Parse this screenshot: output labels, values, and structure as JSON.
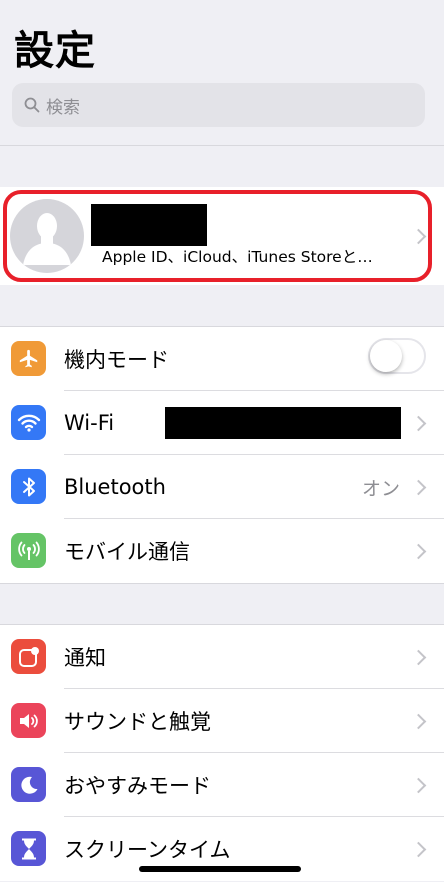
{
  "page": {
    "title": "設定"
  },
  "search": {
    "placeholder": "検索",
    "icon": "search-icon"
  },
  "profile": {
    "subtitle": "Apple ID、iCloud、iTunes Storeと…"
  },
  "groups": [
    {
      "items": [
        {
          "label": "機内モード",
          "icon": "airplane-icon",
          "color": "#f09a37",
          "toggle": false
        },
        {
          "label": "Wi-Fi",
          "icon": "wifi-icon",
          "color": "#3478f6"
        },
        {
          "label": "Bluetooth",
          "icon": "bluetooth-icon",
          "color": "#3478f6",
          "value": "オン"
        },
        {
          "label": "モバイル通信",
          "icon": "cellular-icon",
          "color": "#65c466"
        }
      ]
    },
    {
      "items": [
        {
          "label": "通知",
          "icon": "notifications-icon",
          "color": "#eb4d3d"
        },
        {
          "label": "サウンドと触覚",
          "icon": "speaker-icon",
          "color": "#eb445a"
        },
        {
          "label": "おやすみモード",
          "icon": "moon-icon",
          "color": "#5856d6"
        },
        {
          "label": "スクリーンタイム",
          "icon": "hourglass-icon",
          "color": "#5856d6"
        }
      ]
    }
  ]
}
